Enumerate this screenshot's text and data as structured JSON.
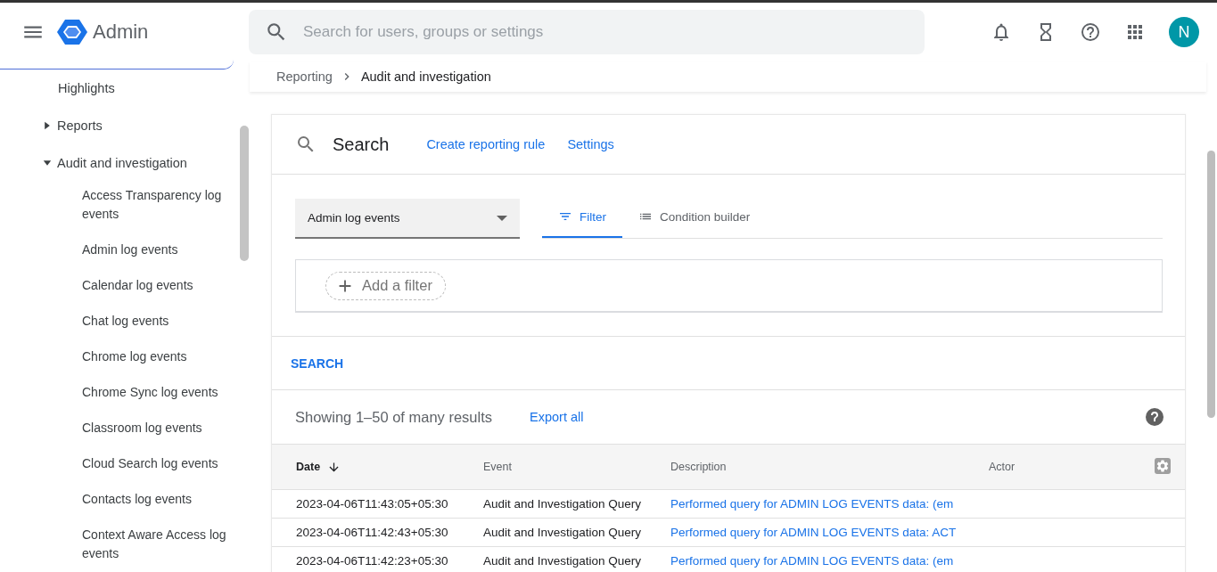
{
  "app": {
    "title": "Admin"
  },
  "search": {
    "placeholder": "Search for users, groups or settings"
  },
  "avatar": {
    "initial": "N"
  },
  "breadcrumb": {
    "parent": "Reporting",
    "current": "Audit and investigation"
  },
  "sidebar": {
    "items": [
      {
        "label": "Highlights"
      },
      {
        "label": "Reports",
        "expanded": false
      },
      {
        "label": "Audit and investigation",
        "expanded": true,
        "children": [
          {
            "label": "Access Transparency log events"
          },
          {
            "label": "Admin log events"
          },
          {
            "label": "Calendar log events"
          },
          {
            "label": "Chat log events"
          },
          {
            "label": "Chrome log events"
          },
          {
            "label": "Chrome Sync log events"
          },
          {
            "label": "Classroom log events"
          },
          {
            "label": "Cloud Search log events"
          },
          {
            "label": "Contacts log events"
          },
          {
            "label": "Context Aware Access log events"
          }
        ]
      }
    ]
  },
  "card": {
    "title": "Search",
    "links": [
      "Create reporting rule",
      "Settings"
    ],
    "source": "Admin log events",
    "tabs": [
      {
        "label": "Filter",
        "kind": "filter",
        "selected": true
      },
      {
        "label": "Condition builder",
        "kind": "list",
        "selected": false
      }
    ],
    "add_filter": "Add a filter",
    "search_button": "SEARCH",
    "summary": "Showing 1–50 of many results",
    "export": "Export all"
  },
  "table": {
    "columns": [
      {
        "label": "Date",
        "sorted": true
      },
      {
        "label": "Event",
        "sorted": false
      },
      {
        "label": "Description",
        "sorted": false
      },
      {
        "label": "Actor",
        "sorted": false
      }
    ],
    "rows": [
      [
        "2023-04-06T11:43:05+05:30",
        "Audit and Investigation Query",
        "Performed query for ADMIN LOG EVENTS data: (em"
      ],
      [
        "2023-04-06T11:42:43+05:30",
        "Audit and Investigation Query",
        "Performed query for ADMIN LOG EVENTS data: ACT"
      ],
      [
        "2023-04-06T11:42:23+05:30",
        "Audit and Investigation Query",
        "Performed query for ADMIN LOG EVENTS data: (em"
      ]
    ]
  }
}
